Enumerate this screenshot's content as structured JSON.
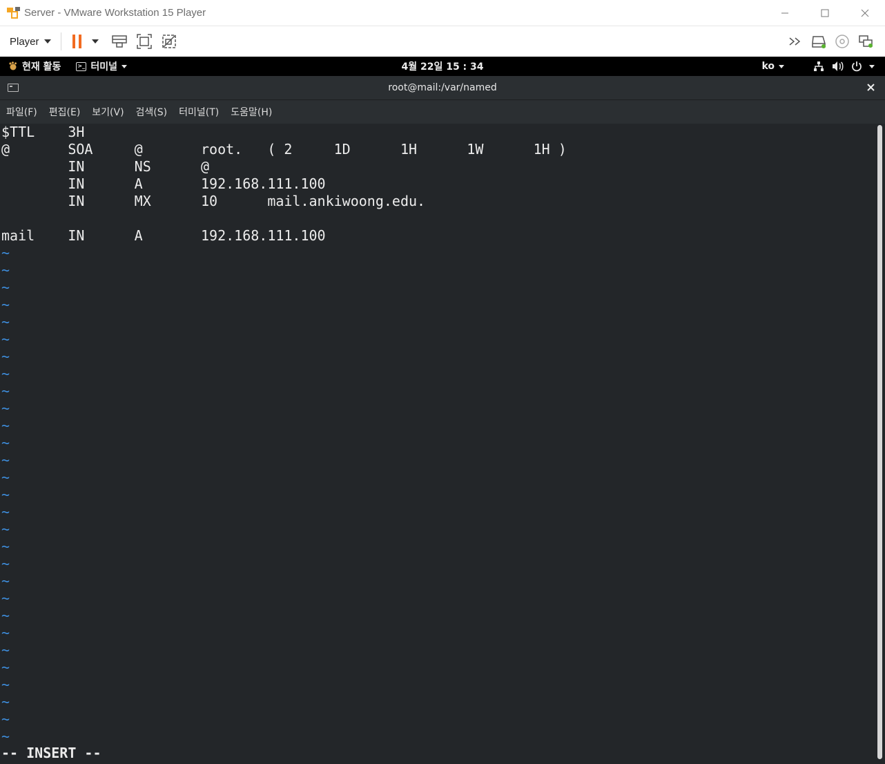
{
  "vmware": {
    "window_title": "Server - VMware Workstation 15 Player",
    "player_menu_label": "Player"
  },
  "gnome": {
    "activities_label": "현재 활동",
    "app_label": "터미널",
    "clock": "4월 22일  15 : 34",
    "input_lang": "ko"
  },
  "terminal": {
    "title": "root@mail:/var/named",
    "menu": [
      "파일(F)",
      "편집(E)",
      "보기(V)",
      "검색(S)",
      "터미널(T)",
      "도움말(H)"
    ],
    "lines": [
      "$TTL    3H",
      "@       SOA     @       root.   ( 2     1D      1H      1W      1H )",
      "        IN      NS      @",
      "        IN      A       192.168.111.100",
      "        IN      MX      10      mail.ankiwoong.edu.",
      "",
      "mail    IN      A       192.168.111.100"
    ],
    "tilde": "~",
    "tilde_count": 29,
    "status": "-- INSERT --"
  },
  "colors": {
    "terminal_bg": "#232629",
    "tilde": "#3e8fdf",
    "pause_icon": "#f26b21"
  },
  "icons": [
    "vmware-logo-icon",
    "minimize-icon",
    "maximize-icon",
    "close-icon",
    "pause-icon",
    "send-ctrl-alt-del-icon",
    "fit-guest-icon",
    "unity-icon",
    "more-icon",
    "hdd-icon",
    "cd-icon",
    "network-adapter-icon",
    "network-icon",
    "volume-icon",
    "power-icon"
  ]
}
